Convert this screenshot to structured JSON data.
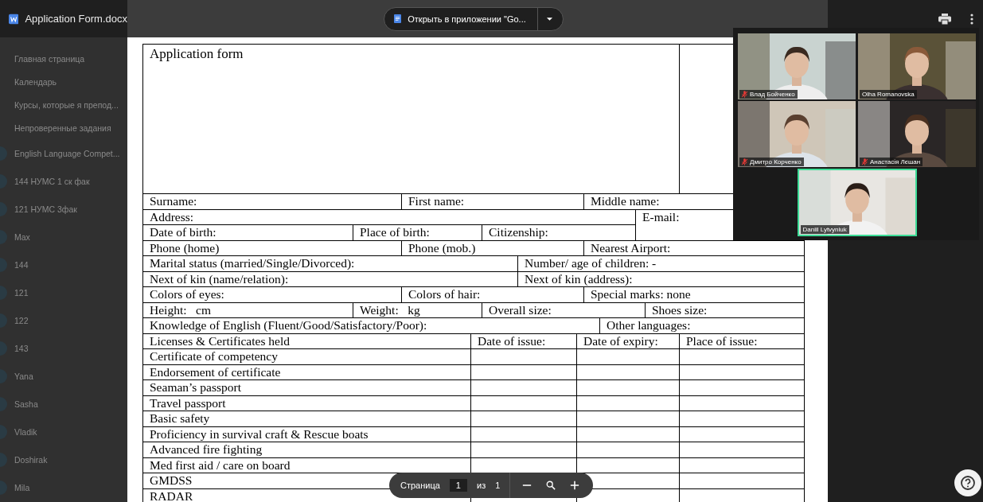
{
  "file": {
    "title": "Application Form.docx"
  },
  "open_button": {
    "label": "Открыть в приложении \"Go..."
  },
  "sidebar": {
    "items": [
      {
        "label": "Главная страница",
        "kind": "nav"
      },
      {
        "label": "Календарь",
        "kind": "nav"
      },
      {
        "label": "Курсы, которые я препод...",
        "kind": "nav"
      },
      {
        "label": "Непроверенные задания",
        "kind": "nav"
      },
      {
        "label": "English Language Compet...",
        "kind": "course"
      },
      {
        "label": "144 НУМС 1 ск фак",
        "kind": "course"
      },
      {
        "label": "121 НУМС 3фак",
        "kind": "course"
      },
      {
        "label": "Max",
        "kind": "course"
      },
      {
        "label": "144",
        "kind": "course"
      },
      {
        "label": "121",
        "kind": "course"
      },
      {
        "label": "122",
        "kind": "course"
      },
      {
        "label": "143",
        "kind": "course"
      },
      {
        "label": "Yana",
        "kind": "course"
      },
      {
        "label": "Sasha",
        "kind": "course"
      },
      {
        "label": "Vladik",
        "kind": "course"
      },
      {
        "label": "Doshirak",
        "kind": "course"
      },
      {
        "label": "Mila",
        "kind": "course"
      }
    ]
  },
  "document": {
    "title": "Application form",
    "rows": [
      {
        "cells": [
          "Surname:",
          "First name:",
          "Middle name:"
        ]
      },
      {
        "cells": [
          "Address:",
          "E-mail:"
        ]
      },
      {
        "cells": [
          "Date of birth:",
          "Place of birth:",
          "Citizenship:"
        ]
      },
      {
        "cells": [
          "Phone (home)",
          "Phone (mob.)",
          "Nearest Airport:"
        ]
      },
      {
        "cells": [
          "Marital status (married/Single/Divorced):",
          "Number/ age of children: -"
        ]
      },
      {
        "cells": [
          "Next of kin (name/relation):",
          "Next of kin (address):"
        ]
      },
      {
        "cells": [
          "Colors of eyes:",
          "Colors of hair:",
          "Special marks: none"
        ]
      },
      {
        "cells": [
          "Height:   cm",
          "Weight:   kg",
          "Overall size:",
          "Shoes size:"
        ]
      },
      {
        "cells": [
          "Knowledge of English (Fluent/Good/Satisfactory/Poor):",
          "Other languages:"
        ]
      },
      {
        "cells": [
          "Licenses & Certificates held",
          "Date of issue:",
          "Date of expiry:",
          "Place of issue:"
        ]
      },
      {
        "cells": [
          "Certificate of competency"
        ]
      },
      {
        "cells": [
          "Endorsement of certificate"
        ]
      },
      {
        "cells": [
          "Seaman’s passport"
        ]
      },
      {
        "cells": [
          "Travel passport"
        ]
      },
      {
        "cells": [
          "Basic safety"
        ]
      },
      {
        "cells": [
          "Proficiency in survival craft & Rescue boats"
        ]
      },
      {
        "cells": [
          "Advanced fire fighting"
        ]
      },
      {
        "cells": [
          "Med first aid / care on board"
        ]
      },
      {
        "cells": [
          "GMDSS"
        ]
      },
      {
        "cells": [
          "RADAR"
        ]
      }
    ]
  },
  "pager": {
    "label": "Страница",
    "page": "1",
    "of": "из",
    "total": "1"
  },
  "participants": [
    {
      "name": "Влад Бойченко",
      "muted": true,
      "speaking": false
    },
    {
      "name": "Olha Romanovska",
      "muted": false,
      "speaking": false
    },
    {
      "name": "Дмитро Корченко",
      "muted": true,
      "speaking": false
    },
    {
      "name": "Анастасія Лєшан",
      "muted": true,
      "speaking": false
    },
    {
      "name": "Daniil Lytvyniuk",
      "muted": false,
      "speaking": true
    }
  ]
}
